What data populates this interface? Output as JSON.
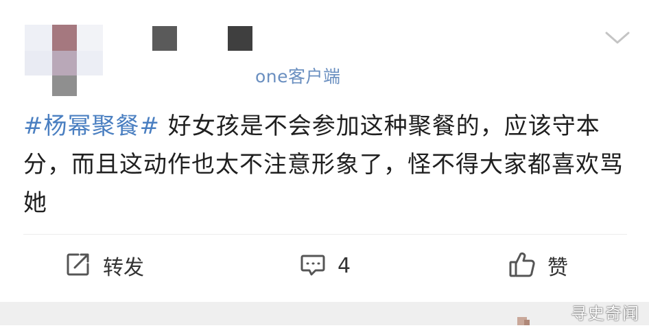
{
  "post": {
    "source_text": "one客户端",
    "topic": "#杨幂聚餐#",
    "body": " 好女孩是不会参加这种聚餐的，应该守本分，而且这动作也太不注意形象了，怪不得大家都喜欢骂她"
  },
  "actions": {
    "repost_label": "转发",
    "comment_count": "4",
    "like_label": "赞"
  },
  "watermark": "寻史奇闻",
  "icons": {
    "more": "chevron-down-icon",
    "repost": "share-icon",
    "comment": "comment-icon",
    "like": "thumbs-up-icon"
  },
  "colors": {
    "topic": "#4a7fc1",
    "client_text": "#6a8fc0",
    "icon": "#555555"
  }
}
